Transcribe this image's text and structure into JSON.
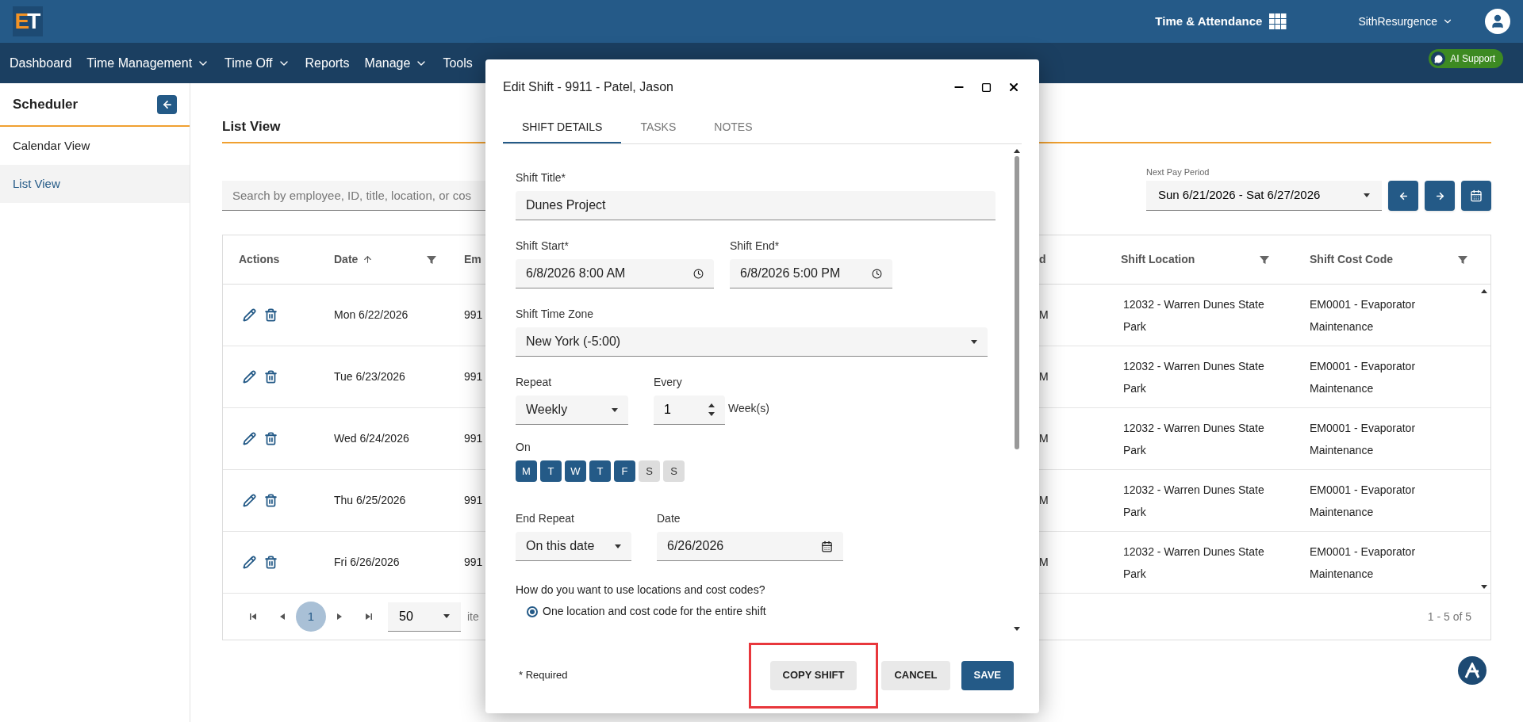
{
  "header": {
    "logo_first": "E",
    "logo_second": "T",
    "app_title": "Time & Attendance",
    "user": "SithResurgence"
  },
  "nav": [
    {
      "label": "Dashboard",
      "has_menu": false
    },
    {
      "label": "Time Management",
      "has_menu": true
    },
    {
      "label": "Time Off",
      "has_menu": true
    },
    {
      "label": "Reports",
      "has_menu": false
    },
    {
      "label": "Manage",
      "has_menu": true
    },
    {
      "label": "Tools",
      "has_menu": false
    }
  ],
  "ai_support": "AI Support",
  "sidebar": {
    "title": "Scheduler",
    "items": [
      {
        "label": "Calendar View",
        "selected": false
      },
      {
        "label": "List View",
        "selected": true
      }
    ]
  },
  "page_title": "List View",
  "search": {
    "placeholder": "Search by employee, ID, title, location, or cos"
  },
  "pay_period": {
    "label": "Next Pay Period",
    "value": "Sun 6/21/2026 - Sat 6/27/2026"
  },
  "table": {
    "columns": [
      {
        "label": "Actions",
        "sorted": false,
        "filter": false
      },
      {
        "label": "Date",
        "sorted": true,
        "filter": true
      },
      {
        "label": "Em",
        "sorted": false,
        "filter": false
      },
      {
        "label": "d",
        "sorted": false,
        "filter": false
      },
      {
        "label": "Shift Location",
        "sorted": false,
        "filter": true
      },
      {
        "label": "Shift Cost Code",
        "sorted": false,
        "filter": true
      }
    ],
    "rows": [
      {
        "date": "Mon 6/22/2026",
        "column_3": "991",
        "column_4": "M",
        "location": "12032 - Warren Dunes State Park",
        "cost_code": "EM0001 - Evaporator Maintenance"
      },
      {
        "date": "Tue 6/23/2026",
        "column_3": "991",
        "column_4": "M",
        "location": "12032 - Warren Dunes State Park",
        "cost_code": "EM0001 - Evaporator Maintenance"
      },
      {
        "date": "Wed 6/24/2026",
        "column_3": "991",
        "column_4": "M",
        "location": "12032 - Warren Dunes State Park",
        "cost_code": "EM0001 - Evaporator Maintenance"
      },
      {
        "date": "Thu 6/25/2026",
        "column_3": "991",
        "column_4": "M",
        "location": "12032 - Warren Dunes State Park",
        "cost_code": "EM0001 - Evaporator Maintenance"
      },
      {
        "date": "Fri 6/26/2026",
        "column_3": "991",
        "column_4": "M",
        "location": "12032 - Warren Dunes State Park",
        "cost_code": "EM0001 - Evaporator Maintenance"
      }
    ]
  },
  "pagination": {
    "page": "1",
    "page_size": "50",
    "items_label": "ite",
    "summary": "1 - 5 of 5"
  },
  "dialog": {
    "title": "Edit Shift - 9911 - Patel, Jason",
    "tabs": [
      {
        "label": "SHIFT DETAILS",
        "selected": true
      },
      {
        "label": "TASKS",
        "selected": false
      },
      {
        "label": "NOTES",
        "selected": false
      }
    ],
    "shift_title": {
      "label": "Shift Title*",
      "value": "Dunes Project"
    },
    "shift_start": {
      "label": "Shift Start*",
      "value": "6/8/2026 8:00 AM"
    },
    "shift_end": {
      "label": "Shift End*",
      "value": "6/8/2026 5:00 PM"
    },
    "time_zone": {
      "label": "Shift Time Zone",
      "value": "New York (-5:00)"
    },
    "repeat": {
      "label": "Repeat",
      "value": "Weekly"
    },
    "every": {
      "label": "Every",
      "value": "1",
      "unit": "Week(s)"
    },
    "on": {
      "label": "On",
      "days": [
        {
          "label": "M",
          "selected": true
        },
        {
          "label": "T",
          "selected": true
        },
        {
          "label": "W",
          "selected": true
        },
        {
          "label": "T",
          "selected": true
        },
        {
          "label": "F",
          "selected": true
        },
        {
          "label": "S",
          "selected": false
        },
        {
          "label": "S",
          "selected": false
        }
      ]
    },
    "end_repeat": {
      "label": "End Repeat",
      "value": "On this date"
    },
    "end_date": {
      "label": "Date",
      "value": "6/26/2026"
    },
    "question": "How do you want to use locations and cost codes?",
    "options": [
      {
        "label": "One location and cost code for the entire shift",
        "selected": true
      }
    ],
    "required_note": "* Required",
    "buttons": [
      {
        "label": "COPY SHIFT",
        "kind": "secondary",
        "highlighted": true
      },
      {
        "label": "CANCEL",
        "kind": "secondary",
        "highlighted": false
      },
      {
        "label": "SAVE",
        "kind": "primary",
        "highlighted": false
      }
    ]
  }
}
